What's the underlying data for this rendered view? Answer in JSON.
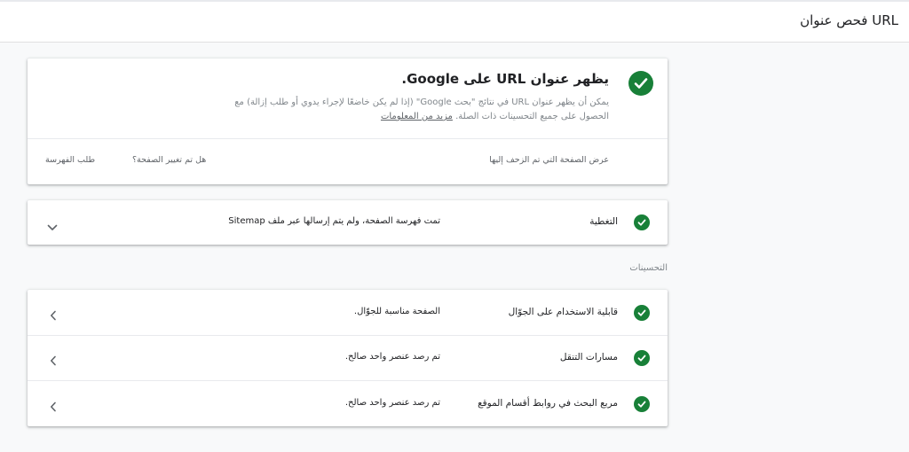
{
  "header": {
    "title": "فحص عنوان URL"
  },
  "main_card": {
    "title": "يظهر عنوان URL على Google.",
    "description": "يمكن أن يظهر عنوان URL في نتائج \"بحث Google\" (إذا لم يكن خاضعًا لإجراء يدوي أو طلب إزالة) مع الحصول على جميع التحسينات ذات الصلة.",
    "learn_more": "مزيد من المعلومات",
    "action_view_crawled": "عرض الصفحة التي تم الزحف إليها",
    "action_changed_q": "هل تم تغيير الصفحة؟",
    "action_request_indexing": "طلب الفهرسة"
  },
  "coverage": {
    "label": "التغطية",
    "value": "تمت فهرسة الصفحة، ولم يتم إرسالها عبر ملف Sitemap"
  },
  "enhancements": {
    "section_label": "التحسينات",
    "rows": [
      {
        "label": "قابلية الاستخدام على الجوّال",
        "value": "الصفحة مناسبة للجوّال."
      },
      {
        "label": "مسارات التنقل",
        "value": "تم رصد عنصر واحد صالح."
      },
      {
        "label": "مربع البحث في روابط أقسام الموقع",
        "value": "تم رصد عنصر واحد صالح."
      }
    ]
  },
  "colors": {
    "success": "#188038",
    "text": "#202124",
    "muted": "#80868b",
    "background": "#f8f9fa"
  },
  "icons": {
    "status": "check-circle-icon",
    "expand": "chevron-down-icon",
    "open": "chevron-left-icon"
  }
}
